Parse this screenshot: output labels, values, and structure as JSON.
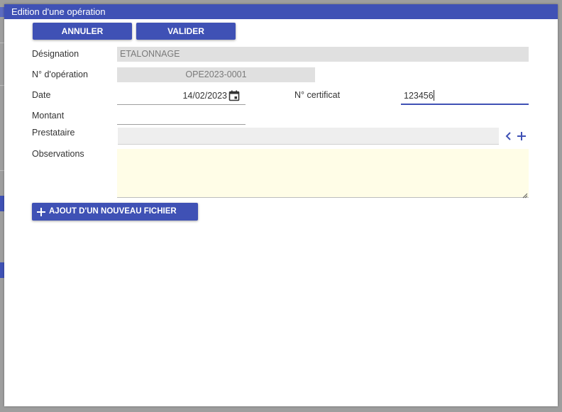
{
  "dialog": {
    "title": "Edition d'une opération"
  },
  "toolbar": {
    "cancel_label": "ANNULER",
    "save_label": "VALIDER"
  },
  "form": {
    "designation": {
      "label": "Désignation",
      "value": "ETALONNAGE"
    },
    "operation_number": {
      "label": "N° d'opération",
      "value": "OPE2023-0001"
    },
    "date": {
      "label": "Date",
      "value": "14/02/2023"
    },
    "certificate": {
      "label": "N° certificat",
      "value": "123456"
    },
    "amount": {
      "label": "Montant",
      "value": ""
    },
    "provider": {
      "label": "Prestataire",
      "value": ""
    },
    "observations": {
      "label": "Observations",
      "value": ""
    }
  },
  "add_file": {
    "label": "AJOUT D'UN NOUVEAU FICHIER"
  },
  "icons": {
    "date": "calendar-icon",
    "provider_back": "chevron-left-icon",
    "provider_add": "plus-icon",
    "add_file": "plus-icon"
  },
  "colors": {
    "primary": "#3f51b5",
    "disabled_field": "#e0e0e0",
    "observations_bg": "#fffde7"
  }
}
